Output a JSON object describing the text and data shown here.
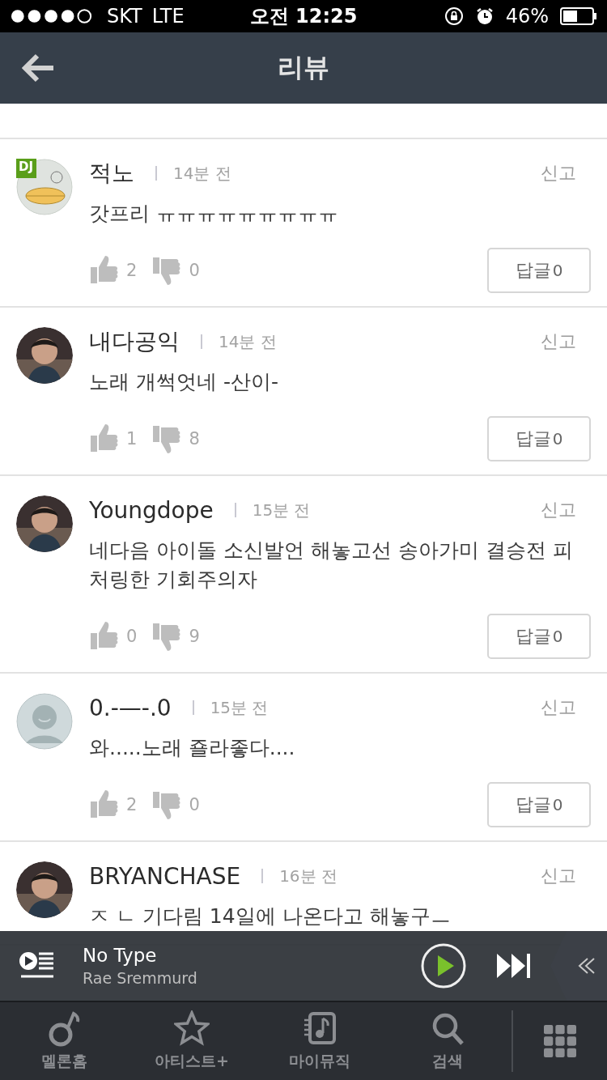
{
  "status_bar": {
    "carrier": "SKT",
    "network": "LTE",
    "time": "오전 12:25",
    "battery": "46%"
  },
  "header": {
    "title": "리뷰"
  },
  "reviews": [
    {
      "avatar": {
        "kind": "duck",
        "badge": "DJ"
      },
      "name": "적노",
      "time": "14분 전",
      "report": "신고",
      "body": "갓프리 ㅠㅠㅠㅠㅠㅠㅠㅠㅠ",
      "likes": "2",
      "dislikes": "0",
      "reply_label": "답글",
      "reply_count": "0"
    },
    {
      "name": "내다공익",
      "time": "14분 전",
      "report": "신고",
      "body": "노래 개썩엇네 -산이-",
      "likes": "1",
      "dislikes": "8",
      "reply_label": "답글",
      "reply_count": "0"
    },
    {
      "name": "Youngdope",
      "time": "15분 전",
      "report": "신고",
      "body": "네다음 아이돌 소신발언 해놓고선 송아가미 결승전 피처링한 기회주의자",
      "likes": "0",
      "dislikes": "9",
      "reply_label": "답글",
      "reply_count": "0"
    },
    {
      "avatar": {
        "kind": "default"
      },
      "name": "0.-—-.0",
      "time": "15분 전",
      "report": "신고",
      "body": "와.....노래 죨라좋다....",
      "likes": "2",
      "dislikes": "0",
      "reply_label": "답글",
      "reply_count": "0"
    },
    {
      "name": "BRYANCHASE",
      "time": "16분 전",
      "report": "신고",
      "body": "ㅈ ㄴ 기다림 14일에 나온다고 해놓구ㅡ"
    }
  ],
  "player": {
    "title": "No Type",
    "artist": "Rae Sremmurd"
  },
  "tab_bar": [
    {
      "label": "멜론홈",
      "kind": "home"
    },
    {
      "label": "아티스트+",
      "kind": "star"
    },
    {
      "label": "마이뮤직",
      "kind": "music"
    },
    {
      "label": "검색",
      "kind": "search"
    },
    {
      "kind": "grid"
    }
  ]
}
